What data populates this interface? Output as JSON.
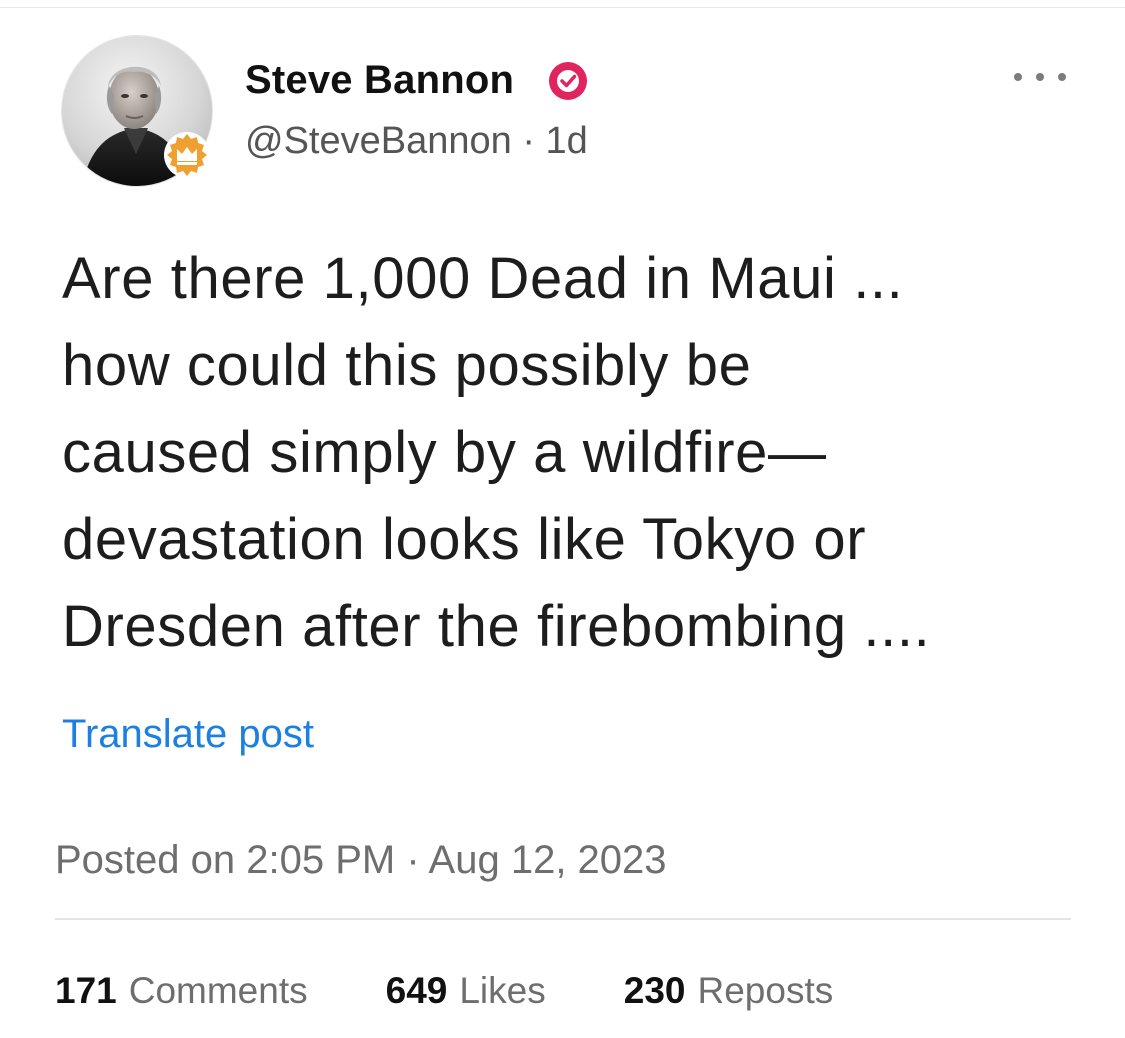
{
  "header": {
    "display_name": "Steve Bannon",
    "handle": "@SteveBannon",
    "separator": "·",
    "age": "1d",
    "verified_color": "#e0245e",
    "badge_color": "#f0a030",
    "icons": [
      "avatar-photo",
      "crown-badge-icon",
      "verified-check-icon",
      "more-dots-icon"
    ]
  },
  "post": {
    "lines": [
      "Are there 1,000 Dead in Maui ...",
      "how could this possibly be",
      "caused simply by a wildfire—",
      "devastation looks like Tokyo or",
      "Dresden after the firebombing ...."
    ],
    "translate_label": "Translate post",
    "posted_at": "Posted on 2:05 PM · Aug 12, 2023"
  },
  "stats": [
    {
      "count": "171",
      "label": "Comments"
    },
    {
      "count": "649",
      "label": "Likes"
    },
    {
      "count": "230",
      "label": "Reposts"
    }
  ],
  "colors": {
    "link": "#1d7fe0",
    "muted": "#6e6e6e"
  }
}
